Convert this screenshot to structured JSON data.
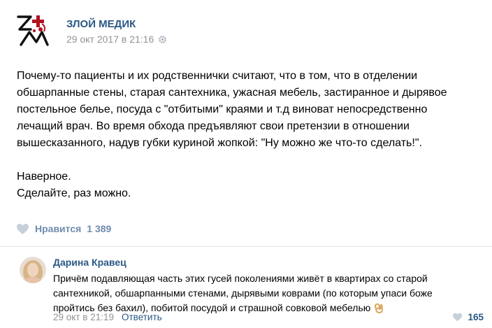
{
  "post": {
    "author": "ЗЛОЙ МЕДИК",
    "date": "29 окт 2017 в 21:16",
    "logo_icon": "zm-logo-icon",
    "paragraphs": [
      "Почему-то пациенты и их родственнички считают, что в том, что в отделении",
      "обшарпанные стены, старая сантехника, ужасная мебель, застиранное и дырявое",
      "постельное белье, посуда с \"отбитыми\" краями и т.д виноват непосредственно",
      "лечащий врач. Во время обхода предъявляют свои претензии в отношении",
      "вышесказанного, надув губки куриной жопкой: \"Ну можно же что-то сделать!\"."
    ],
    "tail": [
      "Наверное.",
      "Сделайте, раз можно."
    ],
    "likes_label": "Нравится",
    "likes_count": "1 389"
  },
  "comment": {
    "author": "Дарина Кравец",
    "lines": [
      "Причём подавляющая часть этих гусей поколениями живёт в квартирах со старой",
      "сантехникой, обшарпанными стенами, дырявыми коврами (по которым упаси боже",
      "пройтись без бахил), побитой посудой и страшной совковой мебелью"
    ],
    "emoji": "ok-hand-icon",
    "date": "29 окт в 21:19",
    "reply_label": "Ответить",
    "likes_count": "165"
  },
  "colors": {
    "link": "#2a5885",
    "muted": "#939393",
    "likes": "#6f8bb0",
    "divider": "#dfe2e8"
  }
}
